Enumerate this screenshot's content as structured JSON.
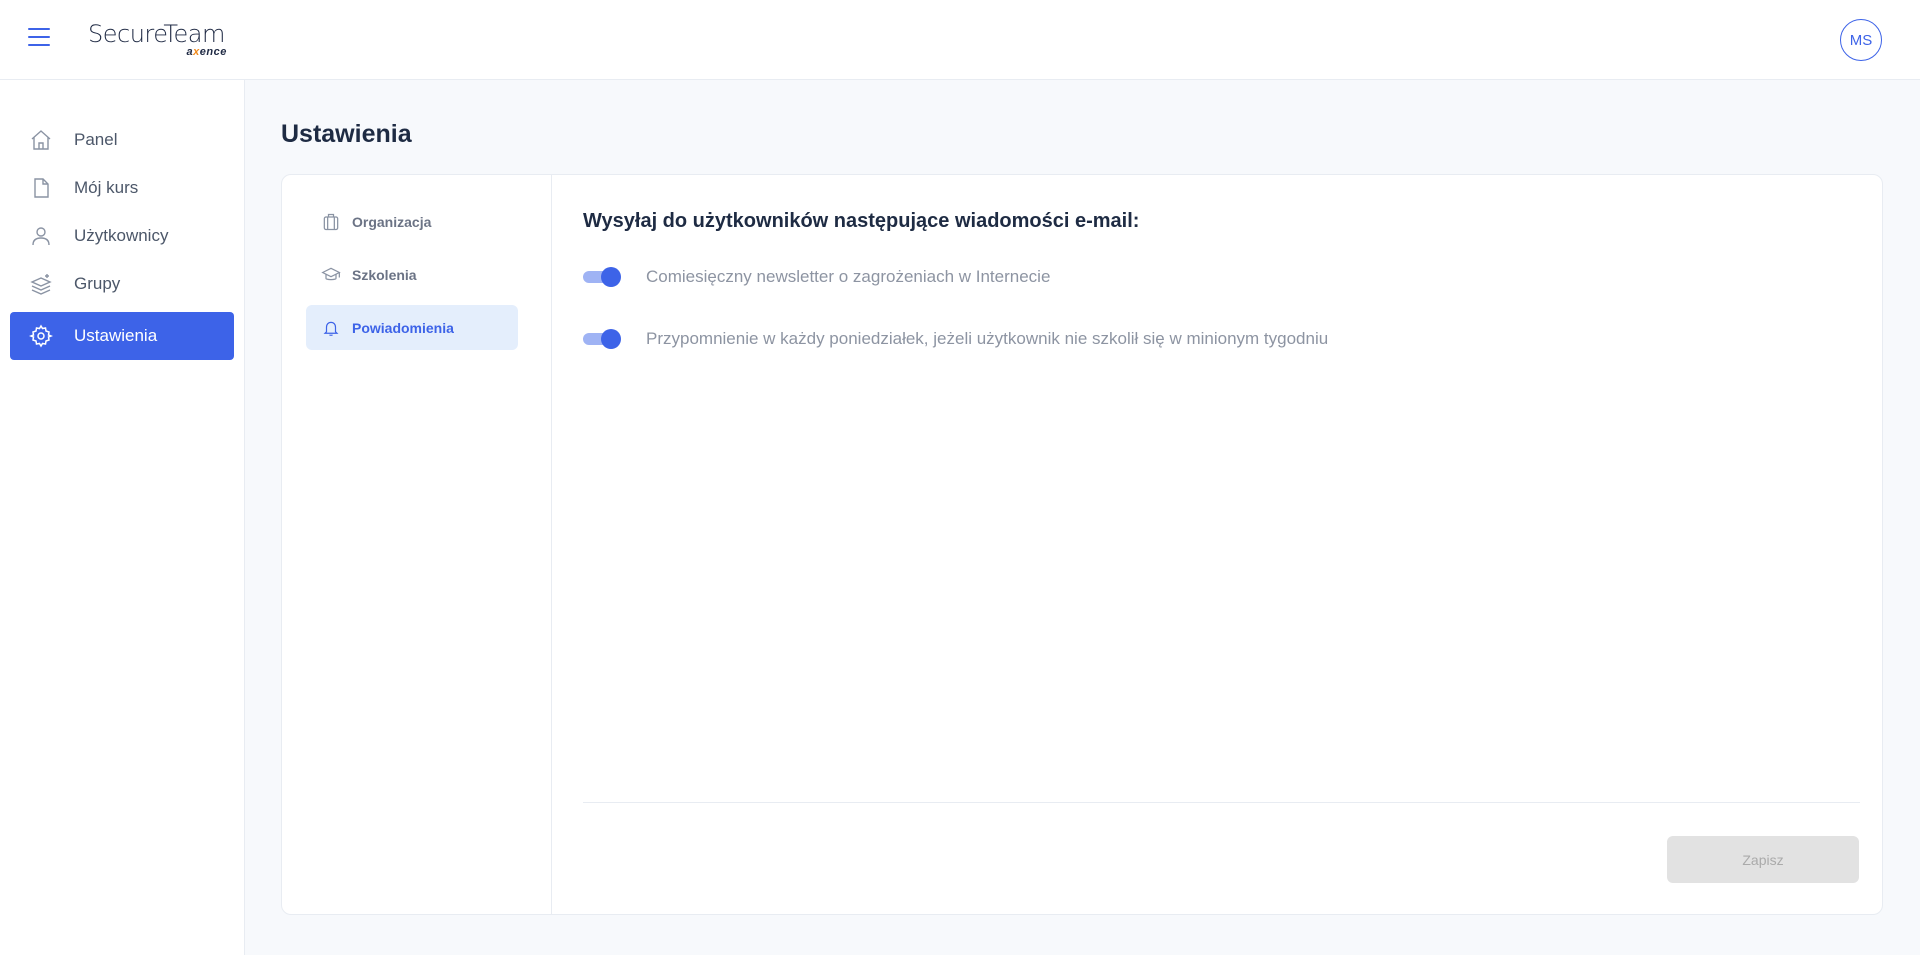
{
  "header": {
    "logo_main": "SecureTeam",
    "logo_sub_pre": "a",
    "logo_sub_x": "x",
    "logo_sub_post": "ence",
    "avatar_initials": "MS"
  },
  "sidebar": {
    "items": [
      {
        "label": "Panel",
        "icon": "home-icon"
      },
      {
        "label": "Mój kurs",
        "icon": "document-icon"
      },
      {
        "label": "Użytkownicy",
        "icon": "user-icon"
      },
      {
        "label": "Grupy",
        "icon": "layers-icon"
      },
      {
        "label": "Ustawienia",
        "icon": "gear-icon",
        "active": true
      }
    ]
  },
  "page": {
    "title": "Ustawienia"
  },
  "subnav": {
    "items": [
      {
        "label": "Organizacja",
        "icon": "briefcase-icon"
      },
      {
        "label": "Szkolenia",
        "icon": "graduation-cap-icon"
      },
      {
        "label": "Powiadomienia",
        "icon": "bell-icon",
        "active": true
      }
    ]
  },
  "notifications": {
    "heading": "Wysyłaj do użytkowników następujące wiadomości e-mail:",
    "options": [
      {
        "label": "Comiesięczny newsletter o zagrożeniach w Internecie",
        "enabled": true
      },
      {
        "label": "Przypomnienie w każdy poniedziałek, jeżeli użytkownik nie szkolił się w minionym tygodniu",
        "enabled": true
      }
    ],
    "save_label": "Zapisz"
  },
  "colors": {
    "accent": "#3d63e8",
    "active_subnav_bg": "#e4eefc",
    "disabled_button_bg": "#e2e2e2"
  }
}
